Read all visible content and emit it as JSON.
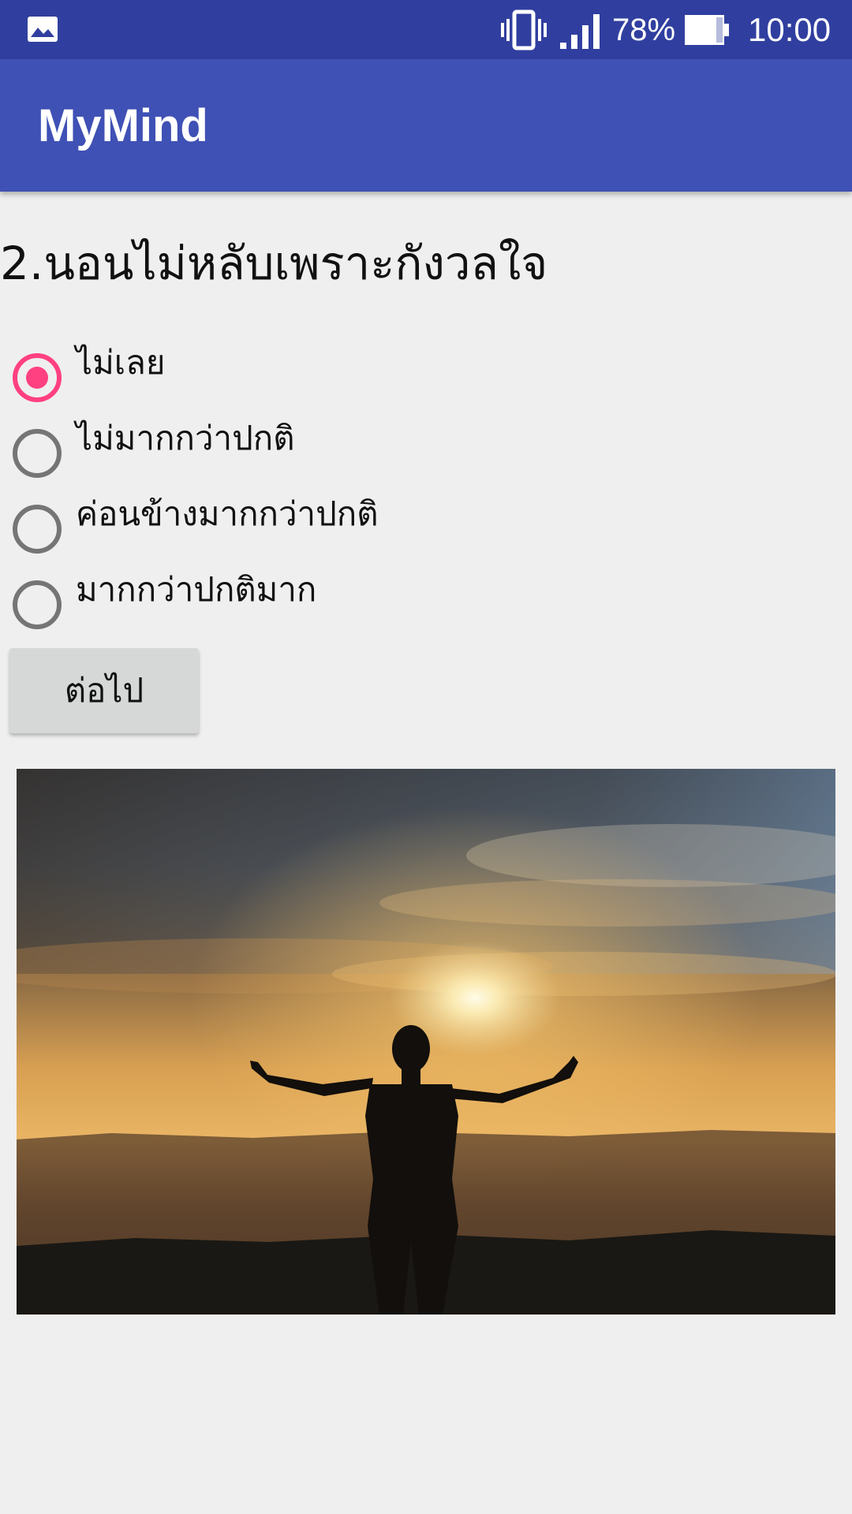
{
  "status_bar": {
    "battery_percent": "78%",
    "time": "10:00",
    "icons": [
      "gallery-icon",
      "vibrate-icon",
      "signal-icon",
      "battery-icon"
    ]
  },
  "app_bar": {
    "title": "MyMind"
  },
  "question": {
    "text": "2.นอนไม่หลับเพราะกังวลใจ"
  },
  "options": [
    {
      "label": "ไม่เลย",
      "selected": true
    },
    {
      "label": "ไม่มากกว่าปกติ",
      "selected": false
    },
    {
      "label": "ค่อนข้างมากกว่าปกติ",
      "selected": false
    },
    {
      "label": "มากกว่าปกติมาก",
      "selected": false
    }
  ],
  "next_button": {
    "label": "ต่อไป"
  },
  "colors": {
    "status_bar": "#303f9f",
    "app_bar": "#3f51b5",
    "accent": "#ff4081",
    "background": "#efefef"
  }
}
